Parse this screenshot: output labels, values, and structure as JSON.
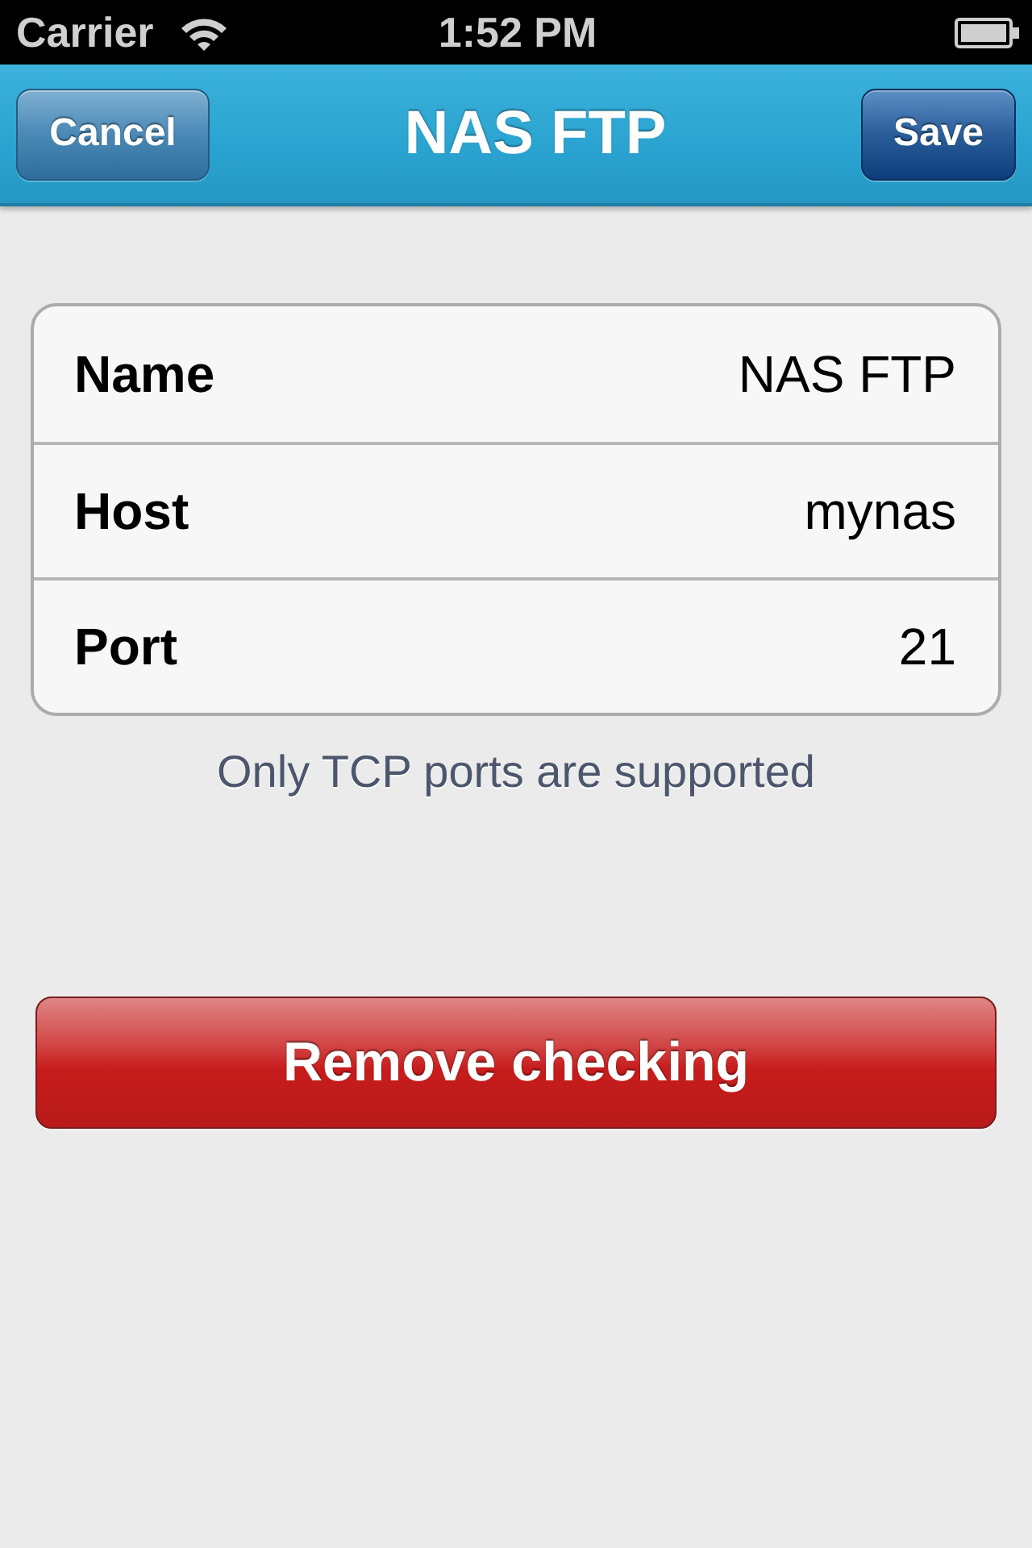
{
  "status_bar": {
    "carrier": "Carrier",
    "time": "1:52 PM"
  },
  "nav_bar": {
    "left_button": "Cancel",
    "title": "NAS FTP",
    "right_button": "Save"
  },
  "form": {
    "rows": [
      {
        "label": "Name",
        "value": "NAS FTP"
      },
      {
        "label": "Host",
        "value": "mynas"
      },
      {
        "label": "Port",
        "value": "21"
      }
    ],
    "footer": "Only TCP ports are supported"
  },
  "remove_button": "Remove checking"
}
